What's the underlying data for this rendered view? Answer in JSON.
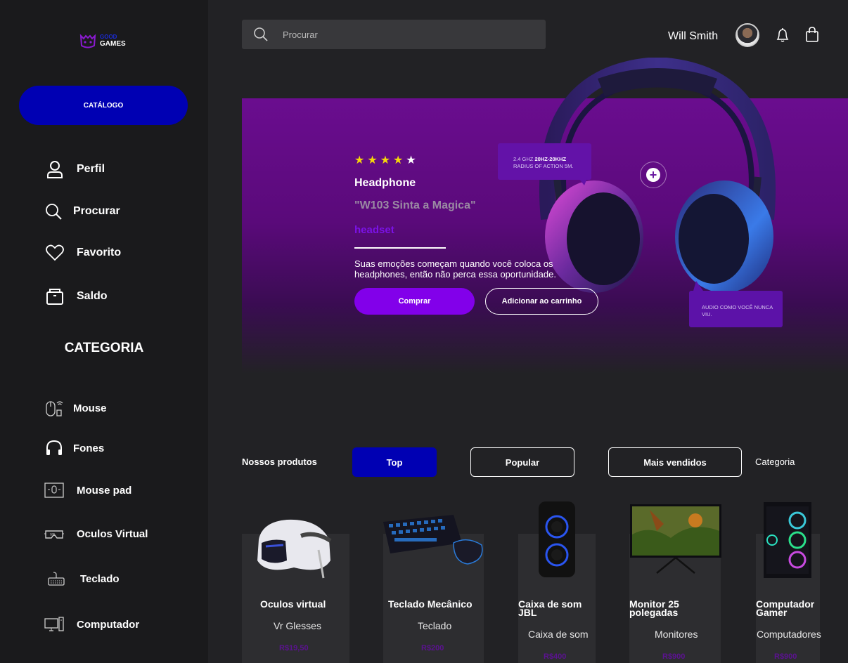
{
  "logo": {
    "line1": "GOOD",
    "line2": "GAMES"
  },
  "sidebar": {
    "catalog_label": "CATÁLOGO",
    "nav": [
      {
        "label": "Perfil",
        "icon": "user-icon"
      },
      {
        "label": "Procurar",
        "icon": "search-icon"
      },
      {
        "label": "Favorito",
        "icon": "heart-icon"
      },
      {
        "label": "Saldo",
        "icon": "wallet-icon"
      }
    ],
    "category_title": "CATEGORIA",
    "categories": [
      {
        "label": "Mouse",
        "icon": "mouse-icon"
      },
      {
        "label": "Fones",
        "icon": "headphones-icon"
      },
      {
        "label": "Mouse pad",
        "icon": "mousepad-icon"
      },
      {
        "label": "Oculos Virtual",
        "icon": "vr-headset-icon"
      },
      {
        "label": "Teclado",
        "icon": "keyboard-icon"
      },
      {
        "label": "Computador",
        "icon": "computer-icon"
      }
    ]
  },
  "header": {
    "search_placeholder": "Procurar",
    "user_name": "Will Smith",
    "icons": [
      "search-icon",
      "avatar",
      "bell-icon",
      "shopping-bag-icon"
    ]
  },
  "hero": {
    "rating": 4,
    "rating_max": 5,
    "stars": [
      "★",
      "★",
      "★",
      "★",
      "★"
    ],
    "title": "Headphone",
    "subtitle": "\"W103 Sinta a Magica\"",
    "tag": "headset",
    "description": "Suas emoções começam quando você coloca os headphones, então não perca essa oportunidade.",
    "buy_label": "Comprar",
    "cart_label": "Adicionar ao carrinho",
    "tooltip1_pre": "2.4 GHZ ",
    "tooltip1_bold": "20HZ-20KHZ",
    "tooltip1_line2": "RADIUS OF ACTION 5M.",
    "tooltip2": "AUDIO COMO VOCÊ NUNCA VIU.",
    "plus_label": "+",
    "accent": "#8200ea",
    "background": "#6a0d8f"
  },
  "products_section": {
    "label": "Nossos produtos",
    "tabs": [
      "Top",
      "Popular",
      "Mais vendidos"
    ],
    "active_tab": "Top",
    "category_label": "Categoria"
  },
  "products": [
    {
      "name": "Oculos virtual",
      "category": "Vr Glesses",
      "price": "R$19,50"
    },
    {
      "name": "Teclado Mecânico",
      "category": "Teclado",
      "price": "R$200"
    },
    {
      "name": "Caixa de som JBL",
      "category": "Caixa de som",
      "price": "R$400"
    },
    {
      "name": "Monitor 25 polegadas",
      "category": "Monitores",
      "price": "R$900"
    },
    {
      "name": "Computador Gamer",
      "category": "Computadores",
      "price": "R$900"
    }
  ],
  "colors": {
    "primary_blue": "#0000b3",
    "purple": "#8200ea",
    "sidebar_bg": "#1a1a1c",
    "page_bg": "#222225"
  }
}
